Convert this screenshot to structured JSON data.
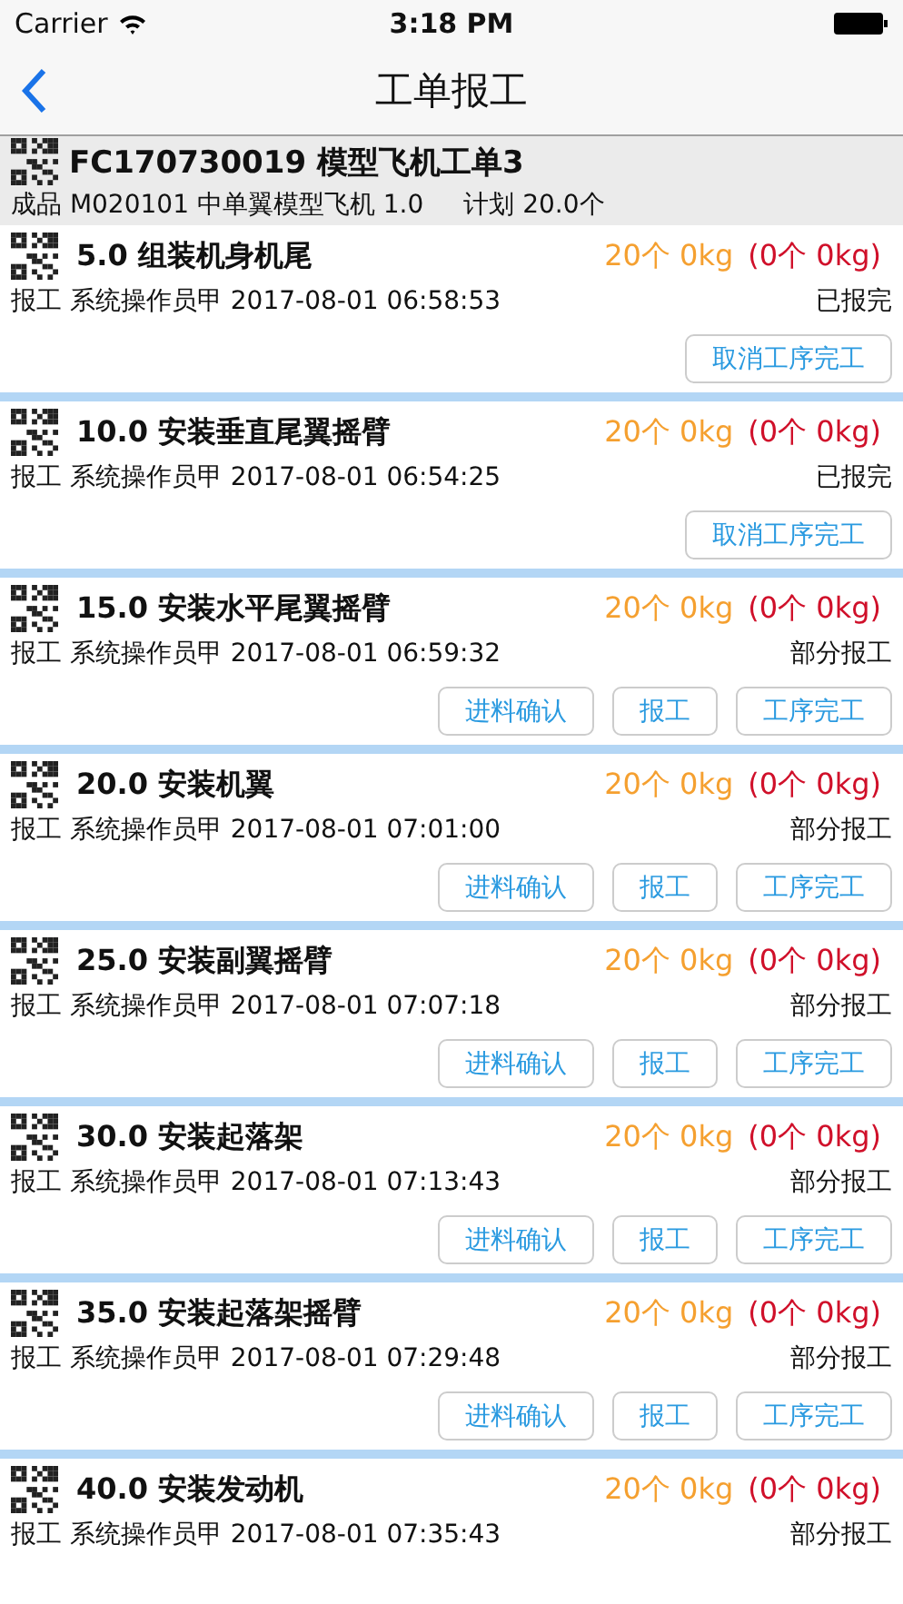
{
  "status_bar": {
    "carrier": "Carrier",
    "time": "3:18 PM"
  },
  "nav": {
    "title": "工单报工"
  },
  "order": {
    "title": "FC170730019 模型飞机工单3",
    "product": "成品 M020101 中单翼模型飞机  1.0",
    "plan": "计划 20.0个"
  },
  "operations": [
    {
      "title": "5.0 组装机身机尾",
      "quantity": "20个 0kg",
      "reported": "(0个 0kg)",
      "info": "报工 系统操作员甲 2017-08-01 06:58:53",
      "status": "已报完",
      "buttons": [
        "取消工序完工"
      ]
    },
    {
      "title": "10.0 安装垂直尾翼摇臂",
      "quantity": "20个 0kg",
      "reported": "(0个 0kg)",
      "info": "报工 系统操作员甲 2017-08-01 06:54:25",
      "status": "已报完",
      "buttons": [
        "取消工序完工"
      ]
    },
    {
      "title": "15.0 安装水平尾翼摇臂",
      "quantity": "20个 0kg",
      "reported": "(0个 0kg)",
      "info": "报工 系统操作员甲 2017-08-01 06:59:32",
      "status": "部分报工",
      "buttons": [
        "进料确认",
        "报工",
        "工序完工"
      ]
    },
    {
      "title": "20.0 安装机翼",
      "quantity": "20个 0kg",
      "reported": "(0个 0kg)",
      "info": "报工 系统操作员甲 2017-08-01 07:01:00",
      "status": "部分报工",
      "buttons": [
        "进料确认",
        "报工",
        "工序完工"
      ]
    },
    {
      "title": "25.0 安装副翼摇臂",
      "quantity": "20个 0kg",
      "reported": "(0个 0kg)",
      "info": "报工 系统操作员甲 2017-08-01 07:07:18",
      "status": "部分报工",
      "buttons": [
        "进料确认",
        "报工",
        "工序完工"
      ]
    },
    {
      "title": "30.0 安装起落架",
      "quantity": "20个 0kg",
      "reported": "(0个 0kg)",
      "info": "报工 系统操作员甲 2017-08-01 07:13:43",
      "status": "部分报工",
      "buttons": [
        "进料确认",
        "报工",
        "工序完工"
      ]
    },
    {
      "title": "35.0 安装起落架摇臂",
      "quantity": "20个 0kg",
      "reported": "(0个 0kg)",
      "info": "报工 系统操作员甲 2017-08-01 07:29:48",
      "status": "部分报工",
      "buttons": [
        "进料确认",
        "报工",
        "工序完工"
      ]
    },
    {
      "title": "40.0 安装发动机",
      "quantity": "20个 0kg",
      "reported": "(0个 0kg)",
      "info": "报工 系统操作员甲 2017-08-01 07:35:43",
      "status": "部分报工"
    }
  ]
}
